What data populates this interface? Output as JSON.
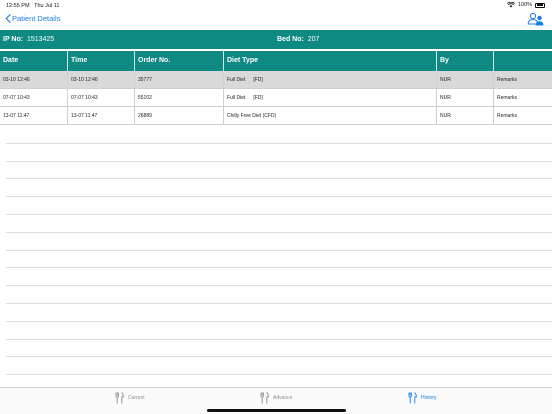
{
  "status_bar": {
    "time": "12:55 PM",
    "date": "Thu Jul 11",
    "battery": "100%"
  },
  "nav": {
    "back_label": "Patient Details",
    "back_icon": "chevron-left-icon",
    "right_icon": "users-icon"
  },
  "patient": {
    "ip_label": "IP No:",
    "ip_value": "1513425",
    "bed_label": "Bed No:",
    "bed_value": "207"
  },
  "table": {
    "headers": [
      "Date",
      "Time",
      "Order No.",
      "Diet Type",
      "By",
      ""
    ],
    "rows": [
      {
        "date": "03-10 12:46",
        "time": "03-10 12:46",
        "order": "35777",
        "diet": "Full Diet",
        "code": "[FD]",
        "by": "NUR",
        "remarks": "Remarks"
      },
      {
        "date": "07-07 10:43",
        "time": "07-07 10:43",
        "order": "55102",
        "diet": "Full Diet",
        "code": "[FD]",
        "by": "NUR",
        "remarks": "Remarks"
      },
      {
        "date": "13-07 11:47",
        "time": "13-07 11:47",
        "order": "26889",
        "diet": "Chilly Free Diet (CFD)",
        "code": "",
        "by": "NUR",
        "remarks": "Remarks"
      }
    ]
  },
  "tabs": [
    {
      "label": "Current",
      "icon": "fork-knife-icon",
      "active": false
    },
    {
      "label": "Advance",
      "icon": "fork-knife-icon",
      "active": false
    },
    {
      "label": "History",
      "icon": "fork-knife-icon",
      "active": true
    }
  ],
  "colors": {
    "accent": "#0f8a82",
    "link": "#1a7fe6"
  }
}
